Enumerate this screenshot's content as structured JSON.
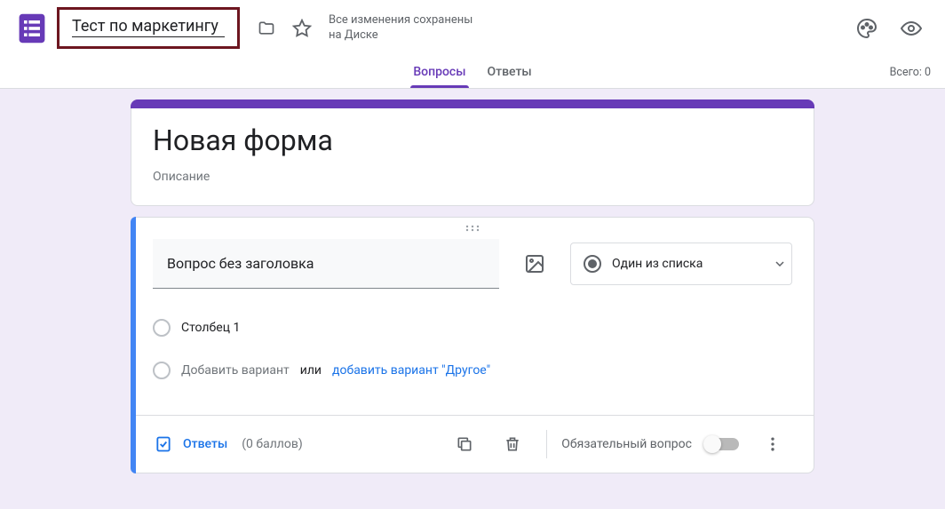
{
  "header": {
    "title": "Тест по маркетингу",
    "status_line1": "Все изменения сохранены",
    "status_line2": "на Диске"
  },
  "tabs": {
    "questions": "Вопросы",
    "responses": "Ответы",
    "total_label": "Всего: 0"
  },
  "form": {
    "title": "Новая форма",
    "description": "Описание"
  },
  "question": {
    "placeholder": "Вопрос без заголовка",
    "type_label": "Один из списка",
    "option1": "Столбец 1",
    "add_option": "Добавить вариант",
    "or": "или",
    "add_other": "добавить вариант \"Другое\""
  },
  "footer": {
    "answers": "Ответы",
    "points": "(0 баллов)",
    "required": "Обязательный вопрос"
  }
}
